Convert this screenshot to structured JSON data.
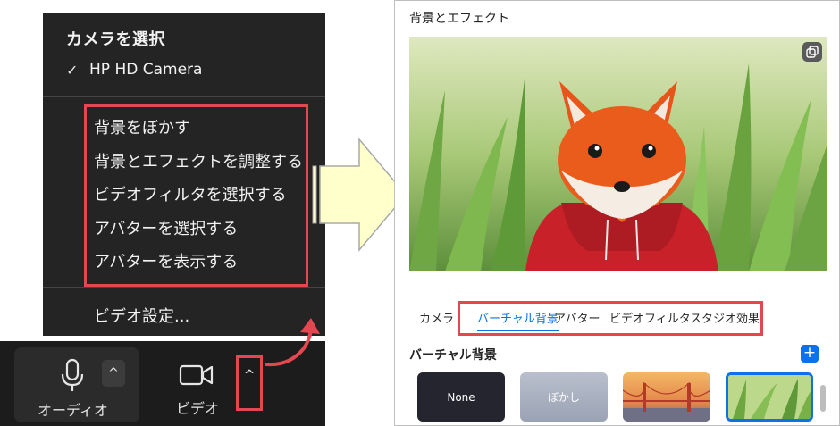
{
  "menu": {
    "title": "カメラを選択",
    "camera_check": "✓",
    "camera_name": "HP HD Camera",
    "items": [
      "背景をぼかす",
      "背景とエフェクトを調整する",
      "ビデオフィルタを選択する",
      "アバターを選択する",
      "アバターを表示する"
    ],
    "video_settings": "ビデオ設定..."
  },
  "toolbar": {
    "audio_label": "オーディオ",
    "video_label": "ビデオ",
    "chevron": "^"
  },
  "panel": {
    "title": "背景とエフェクト",
    "tabs": [
      "カメラ",
      "バーチャル背景",
      "アバター",
      "ビデオフィルタ",
      "スタジオ効果"
    ],
    "active_tab": "バーチャル背景",
    "section_title": "バーチャル背景",
    "add_label": "+",
    "thumbnails": [
      "None",
      "ぼかし"
    ]
  },
  "colors": {
    "accent": "#0e71eb",
    "highlight": "#e4474f",
    "menu_bg": "#242424",
    "arrow_fill": "#ffffcc"
  }
}
